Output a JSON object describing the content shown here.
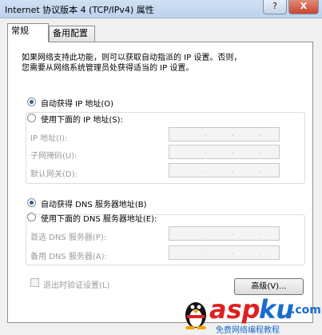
{
  "window": {
    "title": "Internet 协议版本 4 (TCP/IPv4) 属性",
    "help_glyph": "?",
    "close_glyph": "X"
  },
  "tabs": [
    {
      "label": "常规",
      "active": true
    },
    {
      "label": "备用配置",
      "active": false
    }
  ],
  "general": {
    "description_line1": "如果网络支持此功能，则可以获取自动指派的 IP 设置。否则，",
    "description_line2": "您需要从网络系统管理员处获得适当的 IP 设置。",
    "ip_auto_label": "自动获得 IP 地址(O)",
    "ip_auto_selected": true,
    "ip_manual_label": "使用下面的 IP 地址(S):",
    "ip_fields": [
      {
        "label": "IP 地址(I):"
      },
      {
        "label": "子网掩码(U):"
      },
      {
        "label": "默认网关(D):"
      }
    ],
    "dns_auto_label": "自动获得 DNS 服务器地址(B)",
    "dns_auto_selected": true,
    "dns_manual_label": "使用下面的 DNS 服务器地址(E):",
    "dns_fields": [
      {
        "label": "首选 DNS 服务器(P):"
      },
      {
        "label": "备用 DNS 服务器(A):"
      }
    ],
    "ip_separator": ".",
    "validate_label": "退出时验证设置(L)",
    "validate_checked": false,
    "advanced_label": "高级(V)..."
  },
  "watermark": {
    "brand_a": "asp",
    "brand_b": "ku",
    "brand_tld": ".com",
    "tagline": "免费网络编程教程"
  },
  "colors": {
    "selected_radio": "#2b5e9a",
    "disabled_text": "#9b9b9b",
    "watermark_red": "#e02020",
    "watermark_blue": "#1a6ccc"
  }
}
